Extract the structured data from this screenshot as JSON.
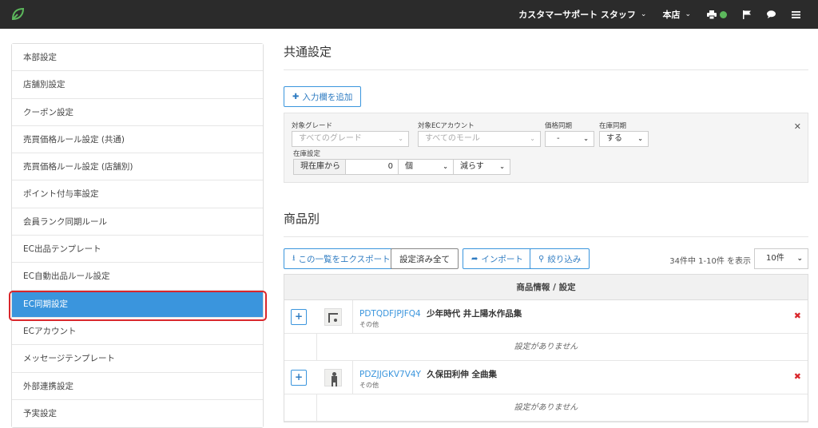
{
  "header": {
    "user_menu": "カスタマーサポート スタッフ",
    "store_menu": "本店",
    "colors": {
      "bar": "#2b2b2b",
      "status": "#5cb85c",
      "logo": "#5cb85c"
    }
  },
  "sidebar": {
    "items": [
      {
        "label": "本部設定"
      },
      {
        "label": "店舗別設定"
      },
      {
        "label": "クーポン設定"
      },
      {
        "label": "売買価格ルール設定 (共通)"
      },
      {
        "label": "売買価格ルール設定 (店舗別)"
      },
      {
        "label": "ポイント付与率設定"
      },
      {
        "label": "会員ランク同期ルール"
      },
      {
        "label": "EC出品テンプレート"
      },
      {
        "label": "EC自動出品ルール設定"
      },
      {
        "label": "EC同期設定",
        "active": true
      },
      {
        "label": "ECアカウント"
      },
      {
        "label": "メッセージテンプレート"
      },
      {
        "label": "外部連携設定"
      },
      {
        "label": "予実設定"
      }
    ],
    "accent": "#3a95dd",
    "highlight_ring": "#d9262b"
  },
  "common": {
    "title": "共通設定",
    "add_button": "入力欄を追加",
    "grade_label": "対象グレード",
    "grade_value": "すべてのグレード",
    "account_label": "対象ECアカウント",
    "account_value": "すべてのモール",
    "price_sync_label": "価格同期",
    "price_sync_value": "-",
    "stock_sync_label": "在庫同期",
    "stock_sync_value": "する",
    "stock_setting_label": "在庫設定",
    "stock_base": "現在庫から",
    "stock_qty": "0",
    "stock_unit": "個",
    "stock_op": "減らす"
  },
  "products": {
    "title": "商品別",
    "buttons": {
      "export": "この一覧をエクスポート",
      "all_set": "設定済み全て",
      "import": "インポート",
      "filter": "絞り込み"
    },
    "count_text": "34件中 1-10件 を表示",
    "per_page": "10件",
    "table_header": "商品情報 / 設定",
    "rows": [
      {
        "code": "PDTQDFJPJFQ4",
        "name": "少年時代 井上陽水作品集",
        "category": "その他",
        "note": "設定がありません"
      },
      {
        "code": "PDZJJGKV7V4Y",
        "name": "久保田利伸 全曲集",
        "category": "その他",
        "note": "設定がありません"
      }
    ]
  }
}
